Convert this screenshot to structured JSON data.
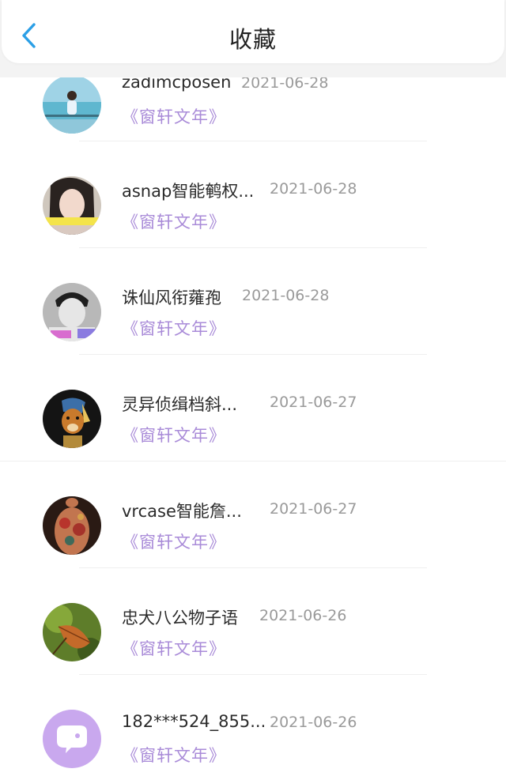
{
  "header": {
    "title": "收藏",
    "back_icon": "chevron-left-icon",
    "accent_color": "#2b9fe6"
  },
  "favorites": [
    {
      "username": "zadimcposen",
      "date": "2021-06-28",
      "book": "《窗轩文年》",
      "avatar_icon": "avatar-photo-girl-sea"
    },
    {
      "username": "asnap智能鹌权...",
      "date": "2021-06-28",
      "book": "《窗轩文年》",
      "avatar_icon": "avatar-photo-girl-peace"
    },
    {
      "username": "诛仙风衔蕹孢",
      "date": "2021-06-28",
      "book": "《窗轩文年》",
      "avatar_icon": "avatar-photo-boy"
    },
    {
      "username": "灵异侦缉档斜...",
      "date": "2021-06-27",
      "book": "《窗轩文年》",
      "avatar_icon": "avatar-painting-dog"
    },
    {
      "username": "vrcase智能詹...",
      "date": "2021-06-27",
      "book": "《窗轩文年》",
      "avatar_icon": "avatar-tattoo-back"
    },
    {
      "username": "忠犬八公物子语",
      "date": "2021-06-26",
      "book": "《窗轩文年》",
      "avatar_icon": "avatar-autumn-leaf"
    },
    {
      "username": "182***524_855...",
      "date": "2021-06-26",
      "book": "《窗轩文年》",
      "avatar_icon": "avatar-default-chat"
    }
  ]
}
